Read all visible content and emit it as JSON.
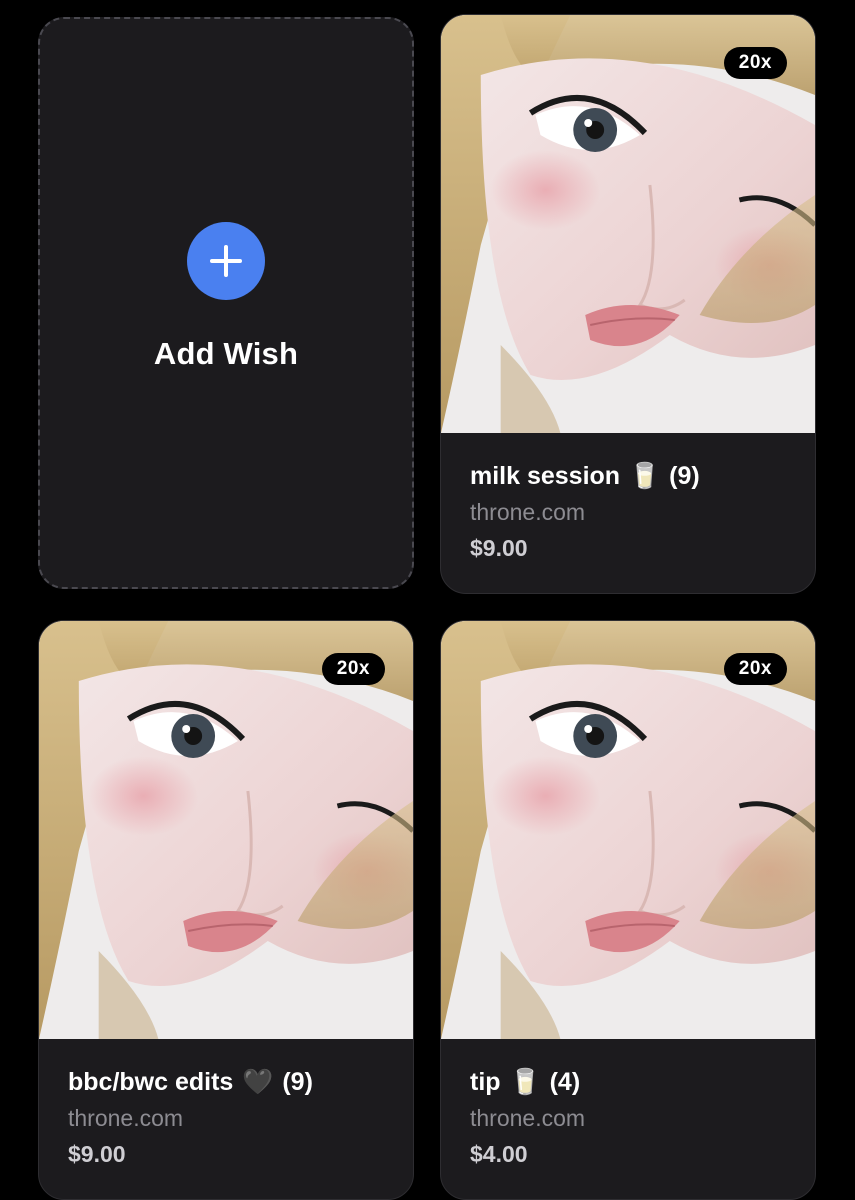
{
  "add_card": {
    "label": "Add Wish"
  },
  "wishes": [
    {
      "title": "milk session",
      "emoji": "🥛",
      "count": "(9)",
      "site": "throne.com",
      "price": "$9.00",
      "badge": "20x"
    },
    {
      "title": "bbc/bwc edits",
      "emoji": "🖤",
      "count": "(9)",
      "site": "throne.com",
      "price": "$9.00",
      "badge": "20x"
    },
    {
      "title": "tip",
      "emoji": "🥛",
      "count": "(4)",
      "site": "throne.com",
      "price": "$4.00",
      "badge": "20x"
    }
  ],
  "colors": {
    "background": "#000000",
    "card": "#1c1b1e",
    "accent_plus": "#4a80f0",
    "muted_text": "#8d8c92"
  },
  "icons": {
    "add": "plus-icon"
  }
}
